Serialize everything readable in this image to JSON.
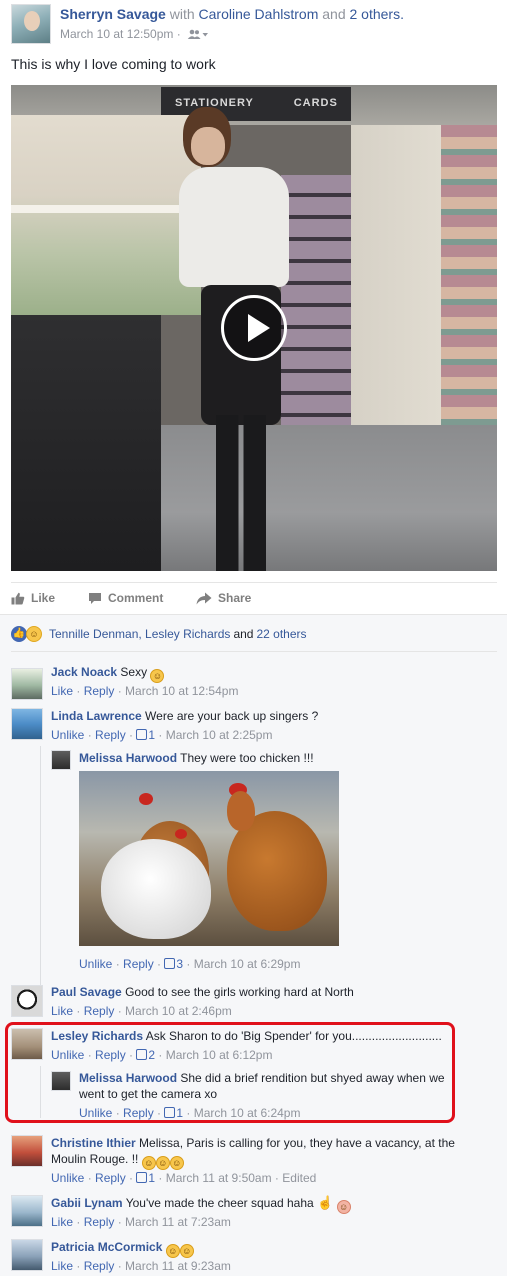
{
  "post": {
    "author": "Sherryn Savage",
    "with_text": "with",
    "tagged_person": "Caroline Dahlstrom",
    "and_text": "and",
    "others_link": "2 others.",
    "timestamp": "March 10 at 12:50pm",
    "separator": "·",
    "audience_icon": "friends-icon",
    "body": "This is why I love coming to work",
    "video_sign_left": "STATIONERY",
    "video_sign_right": "CARDS"
  },
  "actions": {
    "like": "Like",
    "comment": "Comment",
    "share": "Share"
  },
  "reactions": {
    "summary_names": "Tennille Denman, Lesley Richards",
    "summary_connector": "and",
    "summary_others": "22 others"
  },
  "comments": [
    {
      "author": "Jack Noack",
      "text": "Sexy",
      "actions": [
        "Like",
        "Reply"
      ],
      "likes": "",
      "time": "March 10 at 12:54pm",
      "emoji": "slight-smile"
    },
    {
      "author": "Linda Lawrence",
      "text": "Were are your back up singers ?",
      "actions": [
        "Unlike",
        "Reply"
      ],
      "likes": "1",
      "time": "March 10 at 2:25pm",
      "replies": [
        {
          "author": "Melissa Harwood",
          "text": "They were too chicken !!!",
          "actions": [
            "Unlike",
            "Reply"
          ],
          "likes": "3",
          "time": "March 10 at 6:29pm"
        }
      ]
    },
    {
      "author": "Paul Savage",
      "text": "Good to see the girls working hard at North",
      "actions": [
        "Like",
        "Reply"
      ],
      "likes": "",
      "time": "March 10 at 2:46pm"
    },
    {
      "author": "Lesley Richards",
      "text": "Ask Sharon to do 'Big Spender' for you...........................",
      "actions": [
        "Unlike",
        "Reply"
      ],
      "likes": "2",
      "time": "March 10 at 6:12pm",
      "replies": [
        {
          "author": "Melissa Harwood",
          "text_line1": "She did a brief rendition but shyed away when we",
          "text_line2": "went to get the camera xo",
          "actions": [
            "Unlike",
            "Reply"
          ],
          "likes": "1",
          "time": "March 10 at 6:24pm"
        }
      ]
    },
    {
      "author": "Christine Ithier",
      "text_line1": "Melissa, Paris is calling for you, they have a vacancy, at the",
      "text_line2": "Moulin Rouge. !!",
      "actions": [
        "Unlike",
        "Reply"
      ],
      "likes": "1",
      "time": "March 11 at 9:50am",
      "edited": "Edited"
    },
    {
      "author": "Gabii Lynam",
      "text": "You've made the cheer squad haha",
      "actions": [
        "Like",
        "Reply"
      ],
      "likes": "",
      "time": "March 11 at 7:23am"
    },
    {
      "author": "Patricia McCormick",
      "text": "",
      "actions": [
        "Like",
        "Reply"
      ],
      "likes": "",
      "time": "March 11 at 9:23am"
    }
  ],
  "colors": {
    "link": "#365899",
    "highlight": "#e0101b",
    "comment_bg": "#f6f7f9"
  }
}
